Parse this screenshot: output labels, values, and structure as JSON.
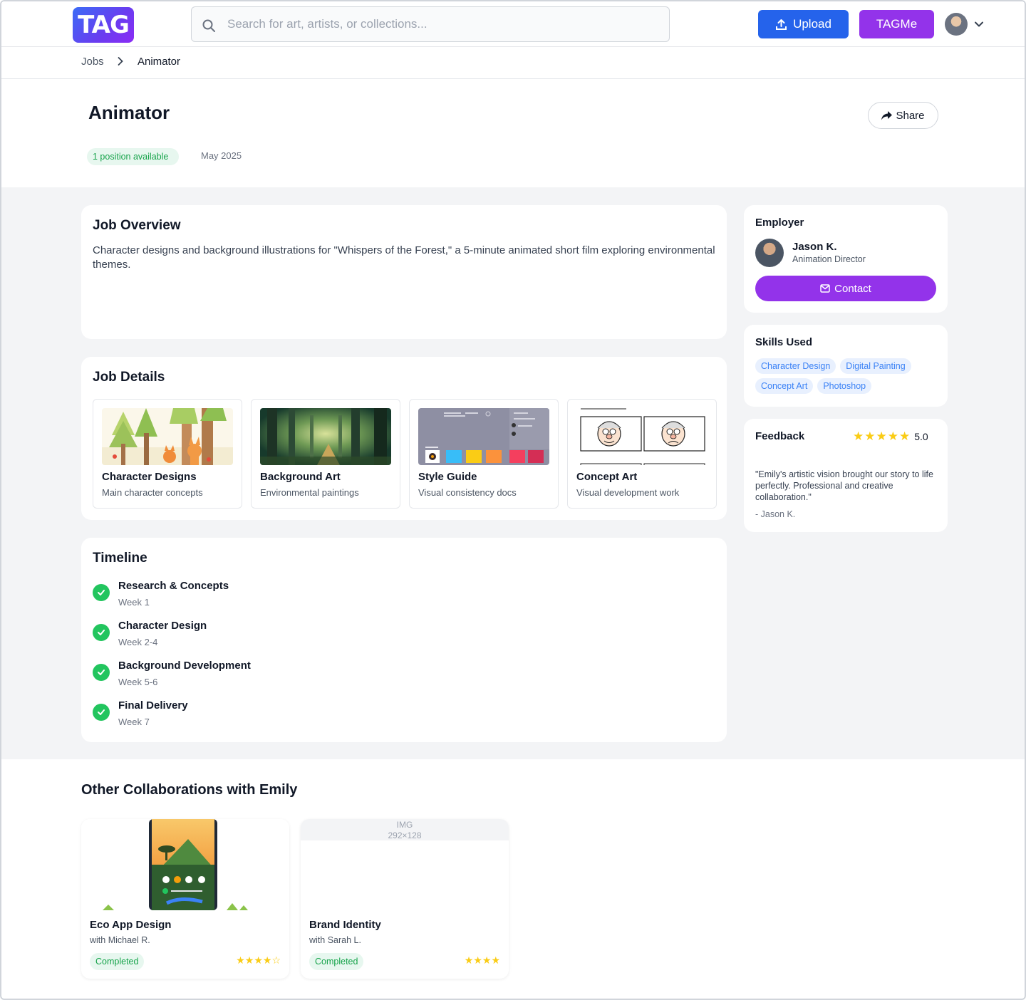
{
  "header": {
    "logo_text": "TAG",
    "search_placeholder": "Search for art, artists, or collections...",
    "upload_label": "Upload",
    "tagme_label": "TAGMe"
  },
  "breadcrumb": {
    "parent": "Jobs",
    "current": "Animator"
  },
  "job": {
    "title": "Animator",
    "share_label": "Share",
    "positions_badge": "1 position available",
    "date": "May 2025"
  },
  "overview": {
    "heading": "Job Overview",
    "text": "Character designs and background illustrations for \"Whispers of the Forest,\" a 5-minute animated short film exploring environmental themes."
  },
  "details": {
    "heading": "Job Details",
    "tiles": [
      {
        "name": "Character Designs",
        "desc": "Main character concepts"
      },
      {
        "name": "Background Art",
        "desc": "Environmental paintings"
      },
      {
        "name": "Style Guide",
        "desc": "Visual consistency docs"
      },
      {
        "name": "Concept Art",
        "desc": "Visual development work"
      }
    ]
  },
  "timeline": {
    "heading": "Timeline",
    "items": [
      {
        "name": "Research & Concepts",
        "week": "Week 1"
      },
      {
        "name": "Character Design",
        "week": "Week 2-4"
      },
      {
        "name": "Background Development",
        "week": "Week 5-6"
      },
      {
        "name": "Final Delivery",
        "week": "Week 7"
      }
    ]
  },
  "employer": {
    "heading": "Employer",
    "name": "Jason K.",
    "role": "Animation Director",
    "contact_label": "Contact"
  },
  "skills": {
    "heading": "Skills Used",
    "items": [
      "Character Design",
      "Digital Painting",
      "Concept Art",
      "Photoshop"
    ]
  },
  "feedback": {
    "heading": "Feedback",
    "rating": "5.0",
    "stars": 5,
    "quote": "\"Emily's artistic vision brought our story to life perfectly. Professional and creative collaboration.\"",
    "author": "- Jason K."
  },
  "collaborations": {
    "heading": "Other Collaborations with Emily",
    "items": [
      {
        "name": "Eco App Design",
        "with": "with Michael R.",
        "status": "Completed",
        "stars": 4,
        "max_stars": 5,
        "stars_text": "★★★★☆"
      },
      {
        "name": "Brand Identity",
        "with": "with Sarah L.",
        "status": "Completed",
        "stars": 4,
        "max_stars": 4,
        "stars_text": "★★★★",
        "image_placeholder": "IMG",
        "image_placeholder_size": "292×128"
      }
    ]
  },
  "colors": {
    "primary_blue": "#2563eb",
    "purple": "#9333ea",
    "success_green": "#22c55e",
    "star_yellow": "#facc15",
    "chip_blue": "#3b82f6"
  }
}
